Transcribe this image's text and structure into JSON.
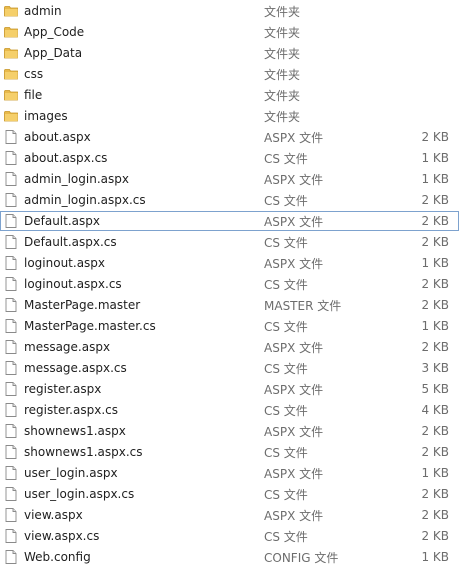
{
  "folder_icon_color": "#e8b94a",
  "file_icon_color": "#ffffff",
  "selection_border_color": "#7da2ce",
  "items": [
    {
      "name": "admin",
      "type": "文件夹",
      "size": "",
      "kind": "folder-icon"
    },
    {
      "name": "App_Code",
      "type": "文件夹",
      "size": "",
      "kind": "folder-icon"
    },
    {
      "name": "App_Data",
      "type": "文件夹",
      "size": "",
      "kind": "folder-icon"
    },
    {
      "name": "css",
      "type": "文件夹",
      "size": "",
      "kind": "folder-icon"
    },
    {
      "name": "file",
      "type": "文件夹",
      "size": "",
      "kind": "folder-icon"
    },
    {
      "name": "images",
      "type": "文件夹",
      "size": "",
      "kind": "folder-icon"
    },
    {
      "name": "about.aspx",
      "type": "ASPX 文件",
      "size": "2 KB",
      "kind": "file-icon"
    },
    {
      "name": "about.aspx.cs",
      "type": "CS 文件",
      "size": "1 KB",
      "kind": "file-icon"
    },
    {
      "name": "admin_login.aspx",
      "type": "ASPX 文件",
      "size": "1 KB",
      "kind": "file-icon"
    },
    {
      "name": "admin_login.aspx.cs",
      "type": "CS 文件",
      "size": "2 KB",
      "kind": "file-icon"
    },
    {
      "name": "Default.aspx",
      "type": "ASPX 文件",
      "size": "2 KB",
      "kind": "file-icon",
      "selected": true
    },
    {
      "name": "Default.aspx.cs",
      "type": "CS 文件",
      "size": "2 KB",
      "kind": "file-icon"
    },
    {
      "name": "loginout.aspx",
      "type": "ASPX 文件",
      "size": "1 KB",
      "kind": "file-icon"
    },
    {
      "name": "loginout.aspx.cs",
      "type": "CS 文件",
      "size": "2 KB",
      "kind": "file-icon"
    },
    {
      "name": "MasterPage.master",
      "type": "MASTER 文件",
      "size": "2 KB",
      "kind": "file-icon"
    },
    {
      "name": "MasterPage.master.cs",
      "type": "CS 文件",
      "size": "1 KB",
      "kind": "file-icon"
    },
    {
      "name": "message.aspx",
      "type": "ASPX 文件",
      "size": "2 KB",
      "kind": "file-icon"
    },
    {
      "name": "message.aspx.cs",
      "type": "CS 文件",
      "size": "3 KB",
      "kind": "file-icon"
    },
    {
      "name": "register.aspx",
      "type": "ASPX 文件",
      "size": "5 KB",
      "kind": "file-icon"
    },
    {
      "name": "register.aspx.cs",
      "type": "CS 文件",
      "size": "4 KB",
      "kind": "file-icon"
    },
    {
      "name": "shownews1.aspx",
      "type": "ASPX 文件",
      "size": "2 KB",
      "kind": "file-icon"
    },
    {
      "name": "shownews1.aspx.cs",
      "type": "CS 文件",
      "size": "2 KB",
      "kind": "file-icon"
    },
    {
      "name": "user_login.aspx",
      "type": "ASPX 文件",
      "size": "1 KB",
      "kind": "file-icon"
    },
    {
      "name": "user_login.aspx.cs",
      "type": "CS 文件",
      "size": "2 KB",
      "kind": "file-icon"
    },
    {
      "name": "view.aspx",
      "type": "ASPX 文件",
      "size": "2 KB",
      "kind": "file-icon"
    },
    {
      "name": "view.aspx.cs",
      "type": "CS 文件",
      "size": "2 KB",
      "kind": "file-icon"
    },
    {
      "name": "Web.config",
      "type": "CONFIG 文件",
      "size": "1 KB",
      "kind": "file-icon"
    }
  ]
}
